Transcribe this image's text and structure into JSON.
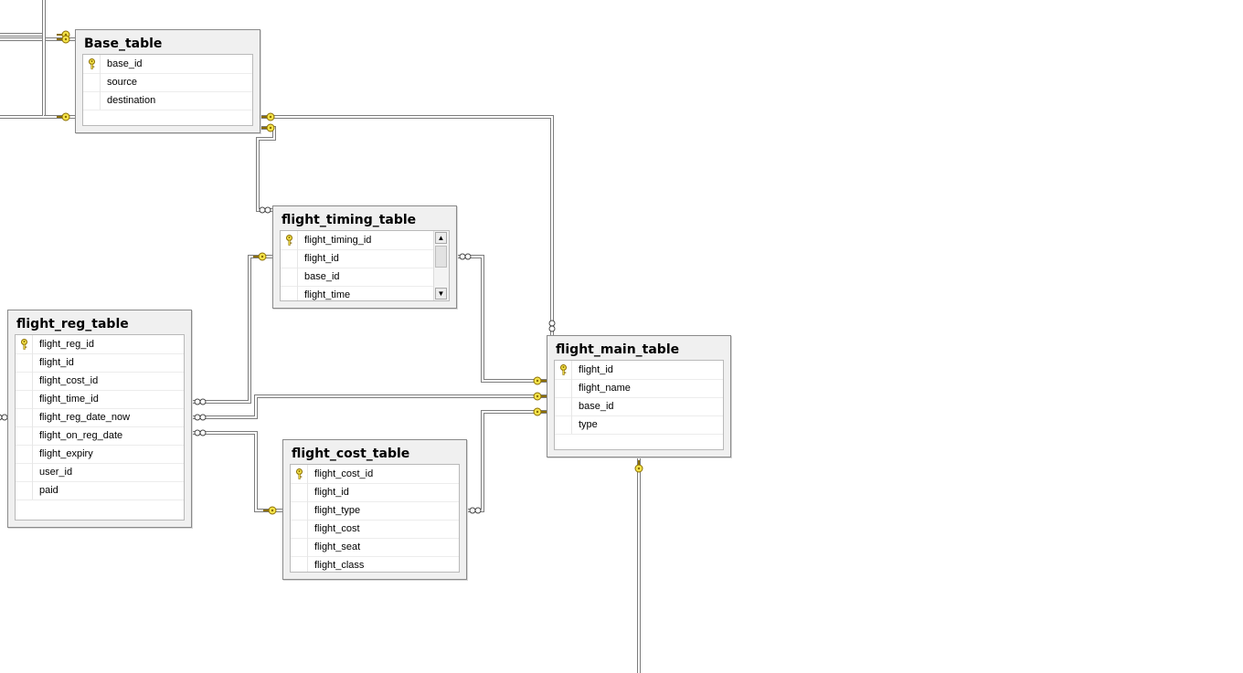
{
  "diagram": {
    "tables": [
      {
        "id": "base",
        "title": "Base_table",
        "columns": [
          {
            "name": "base_id",
            "pk": true
          },
          {
            "name": "source",
            "pk": false
          },
          {
            "name": "destination",
            "pk": false
          }
        ]
      },
      {
        "id": "timing",
        "title": "flight_timing_table",
        "columns": [
          {
            "name": "flight_timing_id",
            "pk": true
          },
          {
            "name": "flight_id",
            "pk": false
          },
          {
            "name": "base_id",
            "pk": false
          },
          {
            "name": "flight_time",
            "pk": false
          }
        ]
      },
      {
        "id": "reg",
        "title": "flight_reg_table",
        "columns": [
          {
            "name": "flight_reg_id",
            "pk": true
          },
          {
            "name": "flight_id",
            "pk": false
          },
          {
            "name": "flight_cost_id",
            "pk": false
          },
          {
            "name": "flight_time_id",
            "pk": false
          },
          {
            "name": "flight_reg_date_now",
            "pk": false
          },
          {
            "name": "flight_on_reg_date",
            "pk": false
          },
          {
            "name": "flight_expiry",
            "pk": false
          },
          {
            "name": "user_id",
            "pk": false
          },
          {
            "name": "paid",
            "pk": false
          }
        ]
      },
      {
        "id": "main",
        "title": "flight_main_table",
        "columns": [
          {
            "name": "flight_id",
            "pk": true
          },
          {
            "name": "flight_name",
            "pk": false
          },
          {
            "name": "base_id",
            "pk": false
          },
          {
            "name": "type",
            "pk": false
          }
        ]
      },
      {
        "id": "cost",
        "title": "flight_cost_table",
        "columns": [
          {
            "name": "flight_cost_id",
            "pk": true
          },
          {
            "name": "flight_id",
            "pk": false
          },
          {
            "name": "flight_type",
            "pk": false
          },
          {
            "name": "flight_cost",
            "pk": false
          },
          {
            "name": "flight_seat",
            "pk": false
          },
          {
            "name": "flight_class",
            "pk": false
          }
        ]
      }
    ],
    "relationships": [
      {
        "from": "base",
        "to": "main"
      },
      {
        "from": "base",
        "to": "timing"
      },
      {
        "from": "main",
        "to": "timing"
      },
      {
        "from": "main",
        "to": "reg"
      },
      {
        "from": "main",
        "to": "cost"
      },
      {
        "from": "timing",
        "to": "reg"
      },
      {
        "from": "cost",
        "to": "reg"
      }
    ],
    "timing_scrollbar": {
      "up_glyph": "▲",
      "down_glyph": "▼"
    }
  },
  "colors": {
    "key_fill": "#f4e34a",
    "key_stroke": "#8a6d00",
    "line": "#7d7d7d",
    "header_bg": "#f0f0f0"
  }
}
